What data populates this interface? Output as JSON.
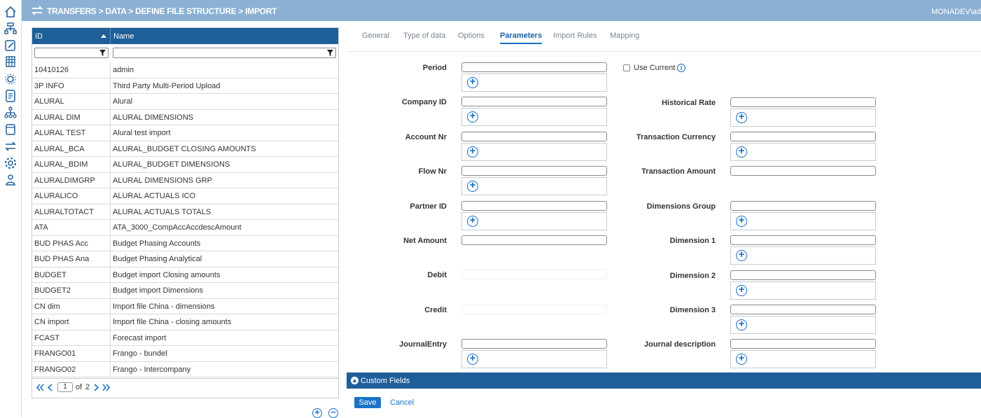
{
  "topbar": {
    "breadcrumb": "TRANSFERS > DATA > DEFINE FILE STRUCTURE > IMPORT",
    "user": "MONADEV\\ad"
  },
  "grid": {
    "col_id": "ID",
    "col_name": "Name",
    "rows": [
      {
        "id": "10410126",
        "name": "admin"
      },
      {
        "id": "3P INFO",
        "name": "Third Party Multi-Period Upload"
      },
      {
        "id": "ALURAL",
        "name": "Alural"
      },
      {
        "id": "ALURAL DIM",
        "name": "ALURAL DIMENSIONS"
      },
      {
        "id": "ALURAL TEST",
        "name": "Alural test import"
      },
      {
        "id": "ALURAL_BCA",
        "name": "ALURAL_BUDGET CLOSING AMOUNTS"
      },
      {
        "id": "ALURAL_BDIM",
        "name": "ALURAL_BUDGET DIMENSIONS"
      },
      {
        "id": "ALURALDIMGRP",
        "name": "ALURAL DIMENSIONS GRP"
      },
      {
        "id": "ALURALICO",
        "name": "ALURAL ACTUALS ICO"
      },
      {
        "id": "ALURALTOTACT",
        "name": "ALURAL ACTUALS TOTALS"
      },
      {
        "id": "ATA",
        "name": "ATA_3000_CompAccAccdescAmount"
      },
      {
        "id": "BUD PHAS Acc",
        "name": "Budget Phasing Accounts"
      },
      {
        "id": "BUD PHAS Ana",
        "name": "Budget Phasing Analytical"
      },
      {
        "id": "BUDGET",
        "name": "Budget import Closing amounts"
      },
      {
        "id": "BUDGET2",
        "name": "Budget import Dimensions"
      },
      {
        "id": "CN dim",
        "name": "Import file China - dimensions"
      },
      {
        "id": "CN import",
        "name": "Import file China - closing amounts"
      },
      {
        "id": "FCAST",
        "name": "Forecast import"
      },
      {
        "id": "FRANGO01",
        "name": "Frango - bundel"
      },
      {
        "id": "FRANGO02",
        "name": "Frango - Intercompany"
      }
    ],
    "pager": {
      "page": "1",
      "of_label": "of",
      "total": "2"
    }
  },
  "tabs": [
    "General",
    "Type of data",
    "Options",
    "Parameters",
    "Import Rules",
    "Mapping"
  ],
  "active_tab": "Parameters",
  "form": {
    "left": [
      {
        "label": "Period",
        "add": true
      },
      {
        "label": "Company ID",
        "add": true
      },
      {
        "label": "Account Nr",
        "add": true
      },
      {
        "label": "Flow Nr",
        "add": true
      },
      {
        "label": "Partner ID",
        "add": true
      },
      {
        "label": "Net Amount",
        "add": false
      },
      {
        "label": "Debit",
        "add": false
      },
      {
        "label": "Credit",
        "add": false
      },
      {
        "label": "JournalEntry",
        "add": true
      }
    ],
    "right": [
      {
        "label": "Historical Rate",
        "add": true
      },
      {
        "label": "Transaction Currency",
        "add": true
      },
      {
        "label": "Transaction Amount",
        "add": false
      },
      {
        "label": "Dimensions Group",
        "add": true
      },
      {
        "label": "Dimension 1",
        "add": true
      },
      {
        "label": "Dimension 2",
        "add": true
      },
      {
        "label": "Dimension 3",
        "add": true
      },
      {
        "label": "Journal description",
        "add": true
      }
    ],
    "use_current_label": "Use Current"
  },
  "custom_fields_label": "Custom Fields",
  "buttons": {
    "save": "Save",
    "cancel": "Cancel"
  }
}
